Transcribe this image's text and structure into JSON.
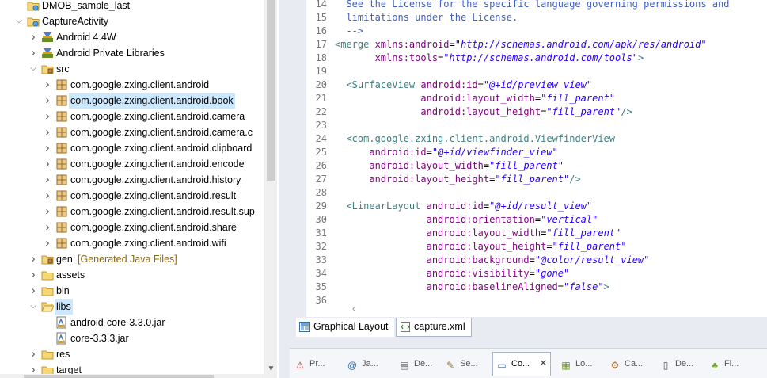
{
  "explorer": {
    "rows": [
      {
        "label": "DMOB_sample_last",
        "arrow": "",
        "icon": "project-icon"
      },
      {
        "label": "CaptureActivity",
        "arrow": "v",
        "icon": "project-icon"
      },
      {
        "label": "Android 4.4W",
        "arrow": ">",
        "icon": "library-icon"
      },
      {
        "label": "Android Private Libraries",
        "arrow": ">",
        "icon": "library-icon"
      },
      {
        "label": "src",
        "arrow": "v",
        "icon": "source-folder-icon"
      },
      {
        "label": "com.google.zxing.client.android",
        "arrow": ">",
        "icon": "package-icon"
      },
      {
        "label": "com.google.zxing.client.android.book",
        "arrow": ">",
        "icon": "package-icon",
        "selected": true
      },
      {
        "label": "com.google.zxing.client.android.camera",
        "arrow": ">",
        "icon": "package-icon"
      },
      {
        "label": "com.google.zxing.client.android.camera.c",
        "arrow": ">",
        "icon": "package-icon"
      },
      {
        "label": "com.google.zxing.client.android.clipboard",
        "arrow": ">",
        "icon": "package-icon"
      },
      {
        "label": "com.google.zxing.client.android.encode",
        "arrow": ">",
        "icon": "package-icon"
      },
      {
        "label": "com.google.zxing.client.android.history",
        "arrow": ">",
        "icon": "package-icon"
      },
      {
        "label": "com.google.zxing.client.android.result",
        "arrow": ">",
        "icon": "package-icon"
      },
      {
        "label": "com.google.zxing.client.android.result.sup",
        "arrow": ">",
        "icon": "package-icon"
      },
      {
        "label": "com.google.zxing.client.android.share",
        "arrow": ">",
        "icon": "package-icon"
      },
      {
        "label": "com.google.zxing.client.android.wifi",
        "arrow": ">",
        "icon": "package-icon"
      },
      {
        "label": "gen",
        "sub": "[Generated Java Files]",
        "arrow": ">",
        "icon": "source-folder-icon"
      },
      {
        "label": "assets",
        "arrow": ">",
        "icon": "folder-icon"
      },
      {
        "label": "bin",
        "arrow": ">",
        "icon": "folder-icon"
      },
      {
        "label": "libs",
        "arrow": "v",
        "icon": "open-folder-icon",
        "selected": true
      },
      {
        "label": "android-core-3.3.0.jar",
        "arrow": "",
        "icon": "jar-icon"
      },
      {
        "label": "core-3.3.3.jar",
        "arrow": "",
        "icon": "jar-icon"
      },
      {
        "label": "res",
        "arrow": ">",
        "icon": "folder-icon"
      },
      {
        "label": "target",
        "arrow": ">",
        "icon": "folder-icon"
      }
    ]
  },
  "editor": {
    "lines": [
      {
        "n": "14",
        "parts": [
          [
            "c",
            "  See the License for the specific language governing permissions and"
          ]
        ]
      },
      {
        "n": "15",
        "parts": [
          [
            "c",
            "  limitations under the License."
          ]
        ]
      },
      {
        "n": "16",
        "parts": [
          [
            "c",
            "  -->"
          ]
        ]
      },
      {
        "n": "17",
        "parts": [
          [
            "t",
            "<merge "
          ],
          [
            "a",
            "xmlns:android"
          ],
          [
            "p",
            "="
          ],
          [
            "v",
            "\"http://schemas.android.com/apk/res/android\""
          ]
        ]
      },
      {
        "n": "18",
        "parts": [
          [
            "p",
            "       "
          ],
          [
            "a",
            "xmlns:tools"
          ],
          [
            "p",
            "="
          ],
          [
            "v",
            "\"http://schemas.android.com/tools\""
          ],
          [
            "t",
            ">"
          ]
        ]
      },
      {
        "n": "19",
        "parts": []
      },
      {
        "n": "20",
        "parts": [
          [
            "p",
            "  "
          ],
          [
            "t",
            "<SurfaceView "
          ],
          [
            "a",
            "android:id"
          ],
          [
            "p",
            "="
          ],
          [
            "v",
            "\"@+id/preview_view\""
          ]
        ]
      },
      {
        "n": "21",
        "parts": [
          [
            "p",
            "               "
          ],
          [
            "a",
            "android:layout_width"
          ],
          [
            "p",
            "="
          ],
          [
            "v",
            "\"fill_parent\""
          ]
        ]
      },
      {
        "n": "22",
        "parts": [
          [
            "p",
            "               "
          ],
          [
            "a",
            "android:layout_height"
          ],
          [
            "p",
            "="
          ],
          [
            "v",
            "\"fill_parent\""
          ],
          [
            "t",
            "/>"
          ]
        ]
      },
      {
        "n": "23",
        "parts": []
      },
      {
        "n": "24",
        "parts": [
          [
            "p",
            "  "
          ],
          [
            "t",
            "<com.google.zxing.client.android.ViewfinderView"
          ]
        ]
      },
      {
        "n": "25",
        "parts": [
          [
            "p",
            "      "
          ],
          [
            "a",
            "android:id"
          ],
          [
            "p",
            "="
          ],
          [
            "v",
            "\"@+id/viewfinder_view\""
          ]
        ]
      },
      {
        "n": "26",
        "parts": [
          [
            "p",
            "      "
          ],
          [
            "a",
            "android:layout_width"
          ],
          [
            "p",
            "="
          ],
          [
            "v",
            "\"fill_parent\""
          ]
        ]
      },
      {
        "n": "27",
        "parts": [
          [
            "p",
            "      "
          ],
          [
            "a",
            "android:layout_height"
          ],
          [
            "p",
            "="
          ],
          [
            "v",
            "\"fill_parent\""
          ],
          [
            "t",
            "/>"
          ]
        ]
      },
      {
        "n": "28",
        "parts": []
      },
      {
        "n": "29",
        "parts": [
          [
            "p",
            "  "
          ],
          [
            "t",
            "<LinearLayout "
          ],
          [
            "a",
            "android:id"
          ],
          [
            "p",
            "="
          ],
          [
            "v",
            "\"@+id/result_view\""
          ]
        ]
      },
      {
        "n": "30",
        "parts": [
          [
            "p",
            "                "
          ],
          [
            "a",
            "android:orientation"
          ],
          [
            "p",
            "="
          ],
          [
            "v",
            "\"vertical\""
          ]
        ]
      },
      {
        "n": "31",
        "parts": [
          [
            "p",
            "                "
          ],
          [
            "a",
            "android:layout_width"
          ],
          [
            "p",
            "="
          ],
          [
            "v",
            "\"fill_parent\""
          ]
        ]
      },
      {
        "n": "32",
        "parts": [
          [
            "p",
            "                "
          ],
          [
            "a",
            "android:layout_height"
          ],
          [
            "p",
            "="
          ],
          [
            "v",
            "\"fill_parent\""
          ]
        ]
      },
      {
        "n": "33",
        "parts": [
          [
            "p",
            "                "
          ],
          [
            "a",
            "android:background"
          ],
          [
            "p",
            "="
          ],
          [
            "v",
            "\"@color/result_view\""
          ]
        ]
      },
      {
        "n": "34",
        "parts": [
          [
            "p",
            "                "
          ],
          [
            "a",
            "android:visibility"
          ],
          [
            "p",
            "="
          ],
          [
            "v",
            "\"gone\""
          ]
        ]
      },
      {
        "n": "35",
        "parts": [
          [
            "p",
            "                "
          ],
          [
            "a",
            "android:baselineAligned"
          ],
          [
            "p",
            "="
          ],
          [
            "v",
            "\"false\""
          ],
          [
            "t",
            ">"
          ]
        ]
      },
      {
        "n": "36",
        "parts": []
      }
    ],
    "tabs": {
      "graphical": "Graphical Layout",
      "xml": "capture.xml"
    }
  },
  "views": {
    "tabs": [
      {
        "label": "Pr...",
        "icon": "problems-icon",
        "glyph": "⚠"
      },
      {
        "label": "Ja...",
        "icon": "javadoc-icon",
        "glyph": "@"
      },
      {
        "label": "De...",
        "icon": "declaration-icon",
        "glyph": "▤"
      },
      {
        "label": "Se...",
        "icon": "search-icon",
        "glyph": "✎"
      },
      {
        "label": "Co...",
        "icon": "console-icon",
        "glyph": "▭",
        "active": true
      },
      {
        "label": "Lo...",
        "icon": "logcat-icon",
        "glyph": "▦"
      },
      {
        "label": "Ca...",
        "icon": "call-hierarchy-icon",
        "glyph": "⚙"
      },
      {
        "label": "De...",
        "icon": "devices-icon",
        "glyph": "▯"
      },
      {
        "label": "Fi...",
        "icon": "android-icon",
        "glyph": "♣"
      }
    ],
    "close_glyph": "✕"
  }
}
